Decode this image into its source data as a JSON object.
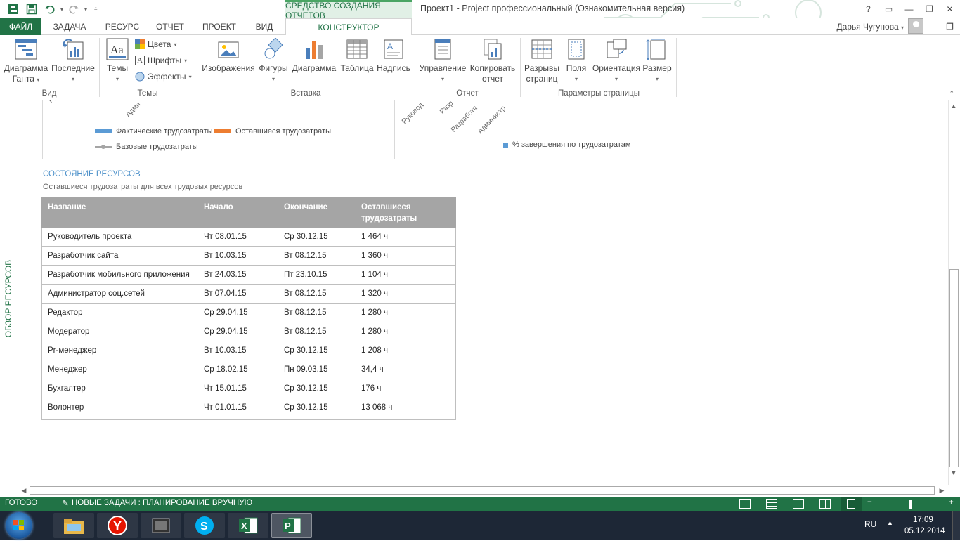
{
  "app": {
    "window_title": "Проект1 - Project профессиональный (Ознакомительная версия)",
    "context_group": "СРЕДСТВО СОЗДАНИЯ ОТЧЕТОВ",
    "help": "?",
    "user": "Дарья Чугунова"
  },
  "tabs": {
    "file": "ФАЙЛ",
    "task": "ЗАДАЧА",
    "resource": "РЕСУРС",
    "report": "ОТЧЕТ",
    "project": "ПРОЕКТ",
    "view": "ВИД",
    "constructor": "КОНСТРУКТОР"
  },
  "ribbon": {
    "gantt": [
      "Диаграмма",
      "Ганта"
    ],
    "recent": "Последние",
    "themes": "Темы",
    "colors": "Цвета",
    "fonts": "Шрифты",
    "effects": "Эффекты",
    "images": "Изображения",
    "shapes": "Фигуры",
    "chart": "Диаграмма",
    "table": "Таблица",
    "textbox": "Надпись",
    "manage": "Управление",
    "copy_report": [
      "Копировать",
      "отчет"
    ],
    "page_breaks": [
      "Разрывы",
      "страниц"
    ],
    "margins": "Поля",
    "orientation": "Ориентация",
    "size": "Размер",
    "groups": {
      "view": "Вид",
      "themes": "Темы",
      "insert": "Вставка",
      "report": "Отчет",
      "page_setup": "Параметры страницы"
    }
  },
  "charts": {
    "left_axis_labels": [
      "Ру",
      "Адми"
    ],
    "left_legend": {
      "actual": "Фактические трудозатраты",
      "remaining": "Оставшиеся трудозатраты",
      "baseline": "Базовые трудозатраты"
    },
    "right_axis_labels": [
      "Руковод",
      "Разр",
      "Разработч",
      "Администр"
    ],
    "right_legend": "% завершения по трудозатратам",
    "colors": {
      "actual": "#5b9bd5",
      "remaining": "#ed7d31",
      "baseline": "#a5a5a5",
      "complete": "#5b9bd5"
    }
  },
  "side_label": "ОБЗОР РЕСУРСОВ",
  "section": {
    "title": "СОСТОЯНИЕ РЕСУРСОВ",
    "subtitle": "Оставшиеся трудозатраты для всех трудовых ресурсов"
  },
  "table": {
    "headers": [
      "Название",
      "Начало",
      "Окончание",
      "Оставшиеся трудозатраты"
    ],
    "rows": [
      [
        "Руководитель проекта",
        "Чт 08.01.15",
        "Ср 30.12.15",
        "1 464 ч"
      ],
      [
        "Разработчик сайта",
        "Вт 10.03.15",
        "Вт 08.12.15",
        "1 360 ч"
      ],
      [
        "Разработчик мобильного приложения",
        "Вт 24.03.15",
        "Пт 23.10.15",
        "1 104 ч"
      ],
      [
        "Администратор соц.сетей",
        "Вт 07.04.15",
        "Вт 08.12.15",
        "1 320 ч"
      ],
      [
        "Редактор",
        "Ср 29.04.15",
        "Вт 08.12.15",
        "1 280 ч"
      ],
      [
        "Модератор",
        "Ср 29.04.15",
        "Вт 08.12.15",
        "1 280 ч"
      ],
      [
        "Pr-менеджер",
        "Вт 10.03.15",
        "Ср 30.12.15",
        "1 208 ч"
      ],
      [
        "Менеджер",
        "Ср 18.02.15",
        "Пн 09.03.15",
        "34,4 ч"
      ],
      [
        "Бухгалтер",
        "Чт 15.01.15",
        "Ср 30.12.15",
        "176 ч"
      ],
      [
        "Волонтер",
        "Чт 01.01.15",
        "Ср 30.12.15",
        "13 068 ч"
      ]
    ]
  },
  "status": {
    "ready": "ГОТОВО",
    "new_tasks": "НОВЫЕ ЗАДАЧИ : ПЛАНИРОВАНИЕ ВРУЧНУЮ",
    "zoom_minus": "−",
    "zoom_plus": "+"
  },
  "taskbar": {
    "lang": "RU",
    "time": "17:09",
    "date": "05.12.2014"
  }
}
